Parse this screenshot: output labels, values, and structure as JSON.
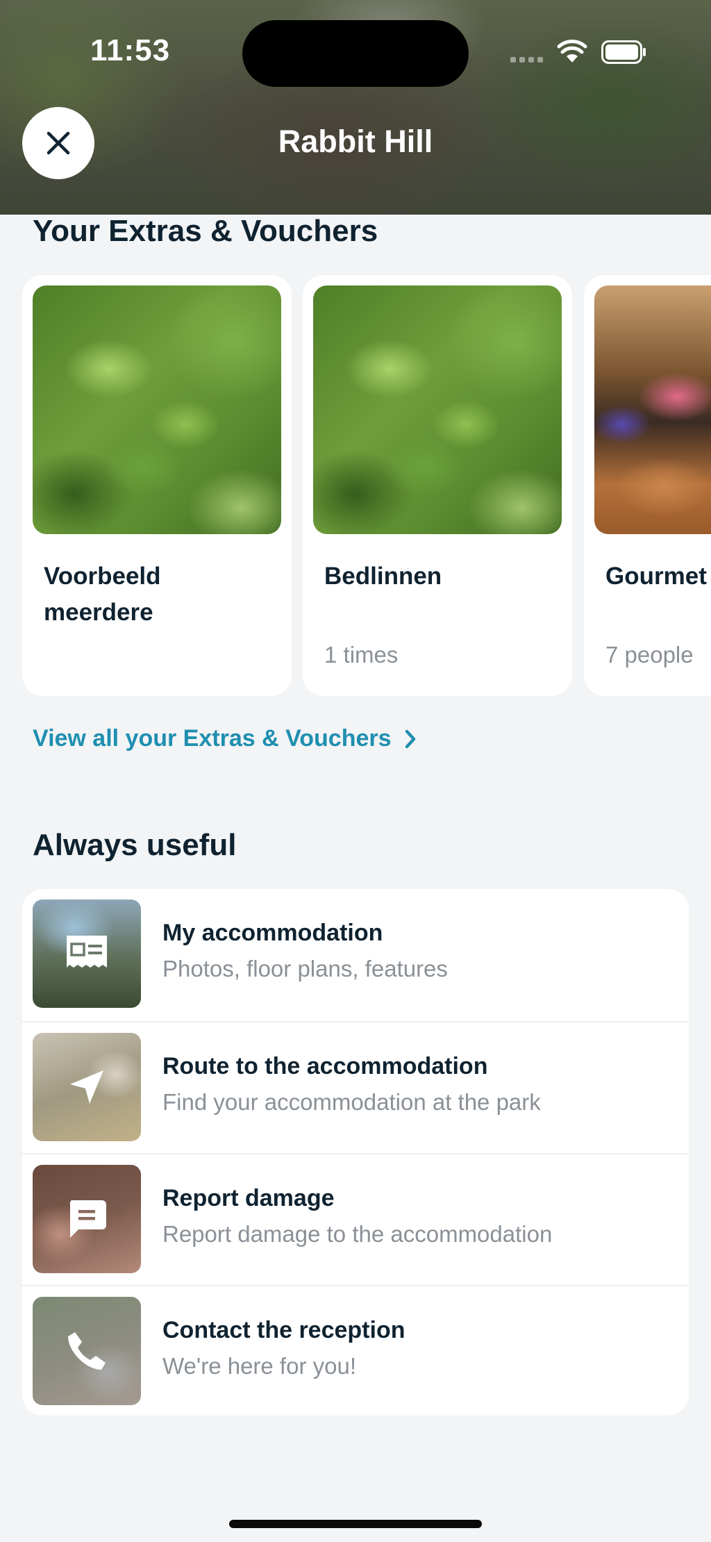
{
  "status_bar": {
    "time": "11:53"
  },
  "header": {
    "title": "Rabbit Hill"
  },
  "extras": {
    "title": "Your Extras & Vouchers",
    "cards": [
      {
        "title": "Voorbeeld meerdere",
        "subtitle": "",
        "image": "leaves-photo"
      },
      {
        "title": "Bedlinnen",
        "subtitle": "1 times",
        "image": "leaves-photo"
      },
      {
        "title": "Gourmet",
        "subtitle": "7 people",
        "image": "dinner-photo"
      }
    ],
    "view_all": "View all your Extras & Vouchers"
  },
  "useful": {
    "title": "Always useful",
    "items": [
      {
        "title": "My accommodation",
        "subtitle": "Photos, floor plans, features",
        "icon": "id-card-icon"
      },
      {
        "title": "Route to the accommodation",
        "subtitle": "Find your accommodation at the park",
        "icon": "navigation-arrow-icon"
      },
      {
        "title": "Report damage",
        "subtitle": "Report damage to the accommodation",
        "icon": "message-icon"
      },
      {
        "title": "Contact the reception",
        "subtitle": "We're here for you!",
        "icon": "phone-icon"
      }
    ]
  },
  "colors": {
    "accent": "#1f8fb0",
    "text": "#0f2230",
    "muted": "#8a9096",
    "background": "#f2f4f6"
  }
}
